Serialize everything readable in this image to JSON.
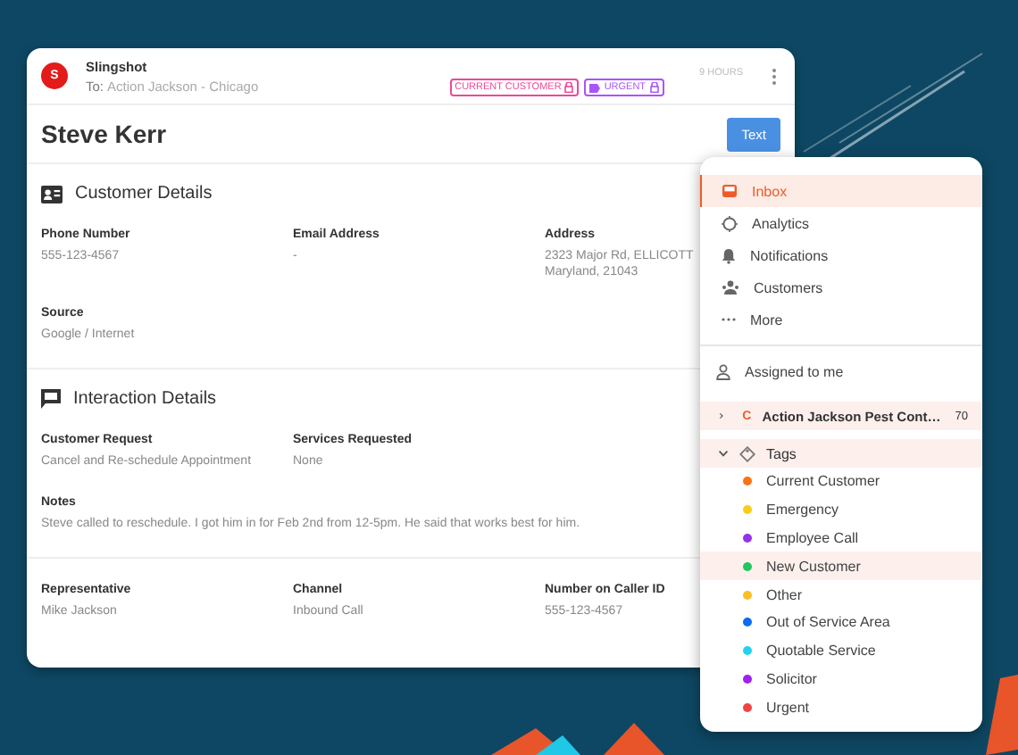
{
  "card": {
    "sender": {
      "initial": "S",
      "name": "Slingshot",
      "to_label": "To:",
      "to": "Action Jackson - Chicago"
    },
    "tags": [
      {
        "label": "CURRENT CUSTOMER",
        "color": "#ec4899",
        "kind": "lock"
      },
      {
        "label": "URGENT",
        "color": "#a855f7",
        "kind": "label"
      }
    ],
    "time": "9 HOURS",
    "contact_name": "Steve Kerr",
    "text_button": "Text",
    "sections": [
      {
        "title": "Customer Details",
        "kind": "contact",
        "rows": [
          [
            {
              "label": "Phone Number",
              "value": "555-123-4567"
            },
            {
              "label": "Email Address",
              "value": "-"
            },
            {
              "label": "Address",
              "value": "2323 Major Rd, ELLICOTT Maryland, 21043"
            }
          ],
          [
            {
              "label": "Source",
              "value": "Google / Internet"
            }
          ]
        ]
      },
      {
        "title": "Interaction Details",
        "kind": "chat",
        "rows": [
          [
            {
              "label": "Customer Request",
              "value": "Cancel and Re-schedule Appointment"
            },
            {
              "label": "Services Requested",
              "value": "None"
            }
          ],
          [
            {
              "label": "Notes",
              "value": "Steve called to reschedule. I got him in for Feb 2nd from 12-5pm. He said that works best for him."
            }
          ]
        ]
      },
      {
        "rows": [
          [
            {
              "label": "Representative",
              "value": "Mike Jackson"
            },
            {
              "label": "Channel",
              "value": "Inbound Call"
            },
            {
              "label": "Number on Caller ID",
              "value": "555-123-4567"
            }
          ]
        ]
      }
    ]
  },
  "menu": {
    "nav": [
      {
        "label": "Inbox",
        "kind": "inbox",
        "selected": true
      },
      {
        "label": "Analytics",
        "kind": "analytics",
        "selected": false
      },
      {
        "label": "Notifications",
        "kind": "bell",
        "selected": false
      },
      {
        "label": "Customers",
        "kind": "people",
        "selected": false
      },
      {
        "label": "More",
        "kind": "dots",
        "selected": false
      }
    ],
    "assigned": {
      "label": "Assigned to me"
    },
    "groups": [
      {
        "kind": "account",
        "initial": "C",
        "label": "Action Jackson Pest Cont…",
        "count": "70",
        "expanded": false
      },
      {
        "kind": "tags",
        "label": "Tags",
        "expanded": true,
        "children": [
          {
            "label": "Current Customer",
            "color": "#f97316",
            "selected": false
          },
          {
            "label": "Emergency",
            "color": "#facc15",
            "selected": false
          },
          {
            "label": "Employee Call",
            "color": "#9333ea",
            "selected": false
          },
          {
            "label": "New Customer",
            "color": "#22c55e",
            "selected": true
          },
          {
            "label": "Other",
            "color": "#fbbf24",
            "selected": false
          },
          {
            "label": "Out of Service Area",
            "color": "#0a6cf0",
            "selected": false
          },
          {
            "label": "Quotable Service",
            "color": "#22d3ee",
            "selected": false
          },
          {
            "label": "Solicitor",
            "color": "#a020f0",
            "selected": false
          },
          {
            "label": "Urgent",
            "color": "#ef4444",
            "selected": false
          }
        ]
      }
    ]
  }
}
